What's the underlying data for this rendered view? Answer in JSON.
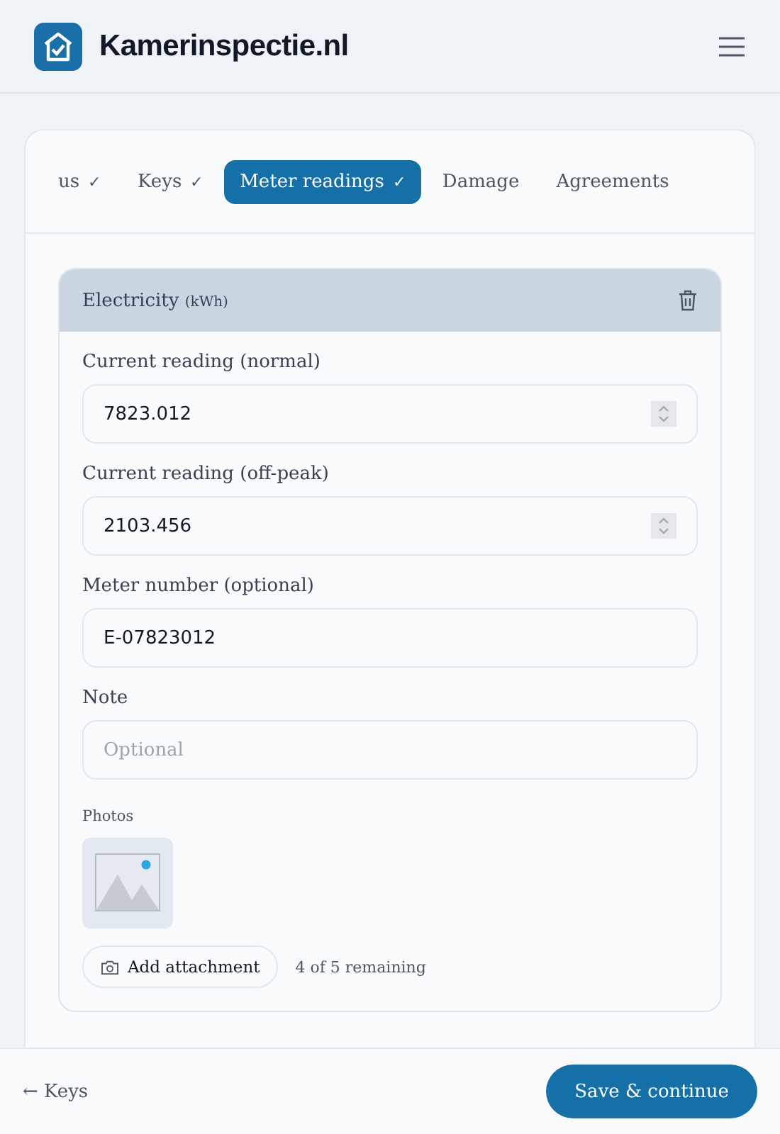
{
  "header": {
    "title": "Kamerinspectie.nl"
  },
  "tabs": [
    {
      "label": "us",
      "mark": "✓",
      "selected": false
    },
    {
      "label": "Keys",
      "mark": "✓",
      "selected": false
    },
    {
      "label": "Meter readings",
      "mark": "✓",
      "selected": true
    },
    {
      "label": "Damage",
      "selected": false
    },
    {
      "label": "Agreements",
      "selected": false
    }
  ],
  "section": {
    "title": "Electricity",
    "unit": "(kWh)",
    "fields": [
      {
        "kind": "number",
        "label": "Current reading (normal)",
        "value": "7823.012"
      },
      {
        "kind": "number",
        "label": "Current reading (off-peak)",
        "value": "2103.456"
      },
      {
        "kind": "text",
        "label": "Meter number (optional)",
        "value": "E-07823012"
      },
      {
        "kind": "text",
        "label": "Note",
        "placeholder": "Optional"
      }
    ],
    "photos": {
      "label": "Photos",
      "add_button": "Add attachment",
      "remaining": "4 of 5 remaining"
    }
  },
  "footer": {
    "back": "← Keys",
    "next": "Save & continue"
  }
}
